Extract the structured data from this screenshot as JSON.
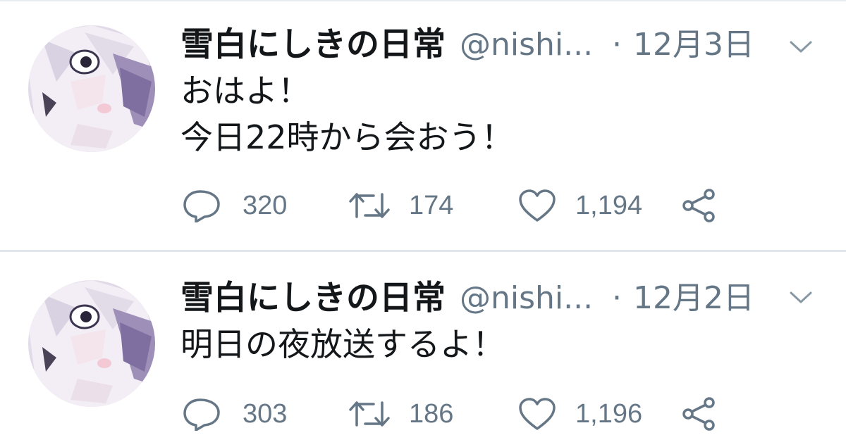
{
  "tweets": [
    {
      "display_name": "雪白にしきの日常",
      "handle": "@nishi...",
      "separator": "·",
      "date": "12月3日",
      "lines": [
        "おはよ！",
        "今日22時から会おう！"
      ],
      "replies": "320",
      "retweets": "174",
      "likes": "1,194"
    },
    {
      "display_name": "雪白にしきの日常",
      "handle": "@nishi...",
      "separator": "·",
      "date": "12月2日",
      "lines": [
        "明日の夜放送するよ！"
      ],
      "replies": "303",
      "retweets": "186",
      "likes": "1,196"
    }
  ],
  "icons": {
    "reply": "speech-bubble-icon",
    "retweet": "retweet-arrows-icon",
    "like": "heart-icon",
    "share": "share-nodes-icon",
    "menu": "chevron-down-icon"
  },
  "colors": {
    "text": "#14171a",
    "secondary": "#657786",
    "divider": "#dfe5ea",
    "background": "#ffffff"
  }
}
